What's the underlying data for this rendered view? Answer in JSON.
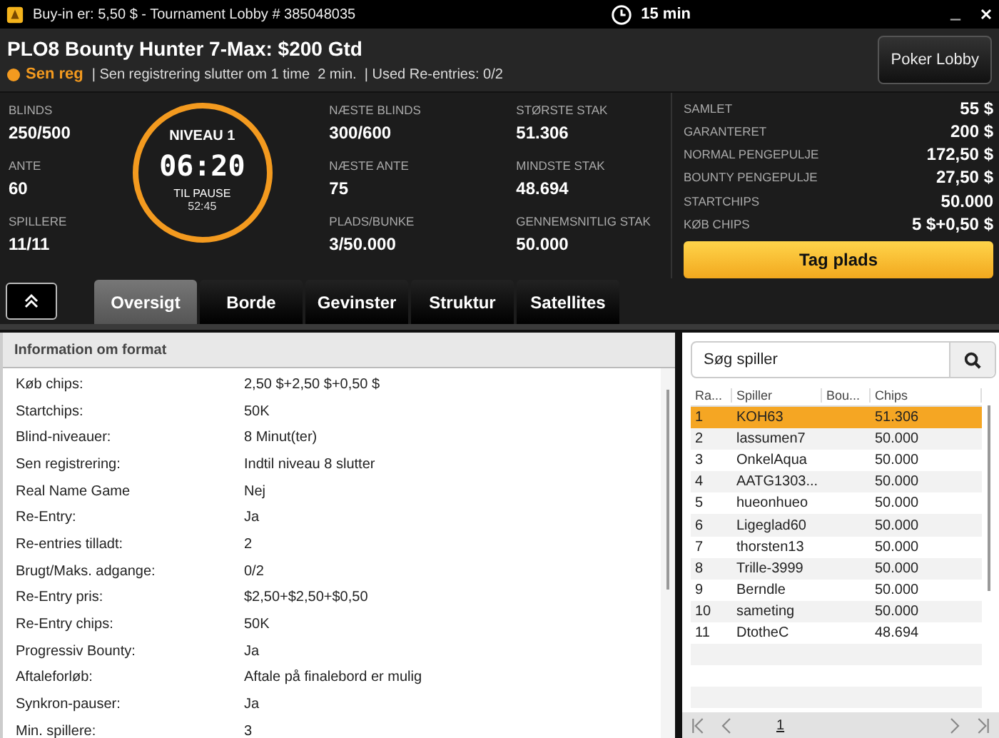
{
  "titlebar": {
    "title": "Buy-in er: 5,50 $ - Tournament Lobby # 385048035",
    "timer": "15 min"
  },
  "header": {
    "name": "PLO8 Bounty Hunter 7-Max: $200 Gtd",
    "status": "Sen reg",
    "info": "| Sen registrering slutter om 1 time  2 min.  | Used Re-entries: 0/2",
    "lobby_button": "Poker Lobby"
  },
  "stats_left": [
    {
      "label": "BLINDS",
      "value": "250/500"
    },
    {
      "label": "ANTE",
      "value": "60"
    },
    {
      "label": "SPILLERE",
      "value": "11/11"
    }
  ],
  "clock": {
    "title": "NIVEAU 1",
    "time": "06:20",
    "pause_label": "TIL PAUSE",
    "pause_time": "52:45"
  },
  "stats_mid": [
    {
      "label": "NÆSTE BLINDS",
      "value": "300/600"
    },
    {
      "label": "NÆSTE ANTE",
      "value": "75"
    },
    {
      "label": "PLADS/BUNKE",
      "value": "3/50.000"
    }
  ],
  "stats_right": [
    {
      "label": "STØRSTE STAK",
      "value": "51.306"
    },
    {
      "label": "MINDSTE STAK",
      "value": "48.694"
    },
    {
      "label": "GENNEMSNITLIG STAK",
      "value": "50.000"
    }
  ],
  "prize": [
    {
      "label": "SAMLET",
      "value": "55 $"
    },
    {
      "label": "GARANTERET",
      "value": "200 $"
    },
    {
      "label": "NORMAL PENGEPULJE",
      "value": "172,50 $"
    },
    {
      "label": "BOUNTY PENGEPULJE",
      "value": "27,50 $"
    },
    {
      "label": "STARTCHIPS",
      "value": "50.000"
    },
    {
      "label": "KØB CHIPS",
      "value": "5 $+0,50 $"
    }
  ],
  "join_button": "Tag plads",
  "tabs": [
    {
      "label": "Oversigt",
      "selected": true
    },
    {
      "label": "Borde",
      "selected": false
    },
    {
      "label": "Gevinster",
      "selected": false
    },
    {
      "label": "Struktur",
      "selected": false
    },
    {
      "label": "Satellites",
      "selected": false
    }
  ],
  "format": {
    "title": "Information om format",
    "rows": [
      {
        "label": "Køb chips:",
        "value": "2,50 $+2,50 $+0,50 $"
      },
      {
        "label": "Startchips:",
        "value": "50K"
      },
      {
        "label": "Blind-niveauer:",
        "value": "8 Minut(ter)"
      },
      {
        "label": "Sen registrering:",
        "value": "Indtil niveau 8 slutter"
      },
      {
        "label": "Real Name Game",
        "value": "Nej"
      },
      {
        "label": "Re-Entry:",
        "value": "Ja"
      },
      {
        "label": "Re-entries tilladt:",
        "value": "2"
      },
      {
        "label": "Brugt/Maks. adgange:",
        "value": "0/2"
      },
      {
        "label": "Re-Entry pris:",
        "value": "$2,50+$2,50+$0,50"
      },
      {
        "label": "Re-Entry chips:",
        "value": "50K"
      },
      {
        "label": "Progressiv Bounty:",
        "value": "Ja"
      },
      {
        "label": "Aftaleforløb:",
        "value": "Aftale på finalebord er mulig"
      },
      {
        "label": "Synkron-pauser:",
        "value": "Ja"
      },
      {
        "label": "Min. spillere:",
        "value": "3"
      }
    ]
  },
  "players": {
    "search_placeholder": "Søg spiller",
    "columns": [
      "Ra...",
      "Spiller",
      "Bou...",
      "Chips"
    ],
    "rows": [
      {
        "rank": "1",
        "name": "KOH63",
        "chips": "51.306",
        "selected": true
      },
      {
        "rank": "2",
        "name": "lassumen7",
        "chips": "50.000",
        "selected": false
      },
      {
        "rank": "3",
        "name": "OnkelAqua",
        "chips": "50.000",
        "selected": false
      },
      {
        "rank": "4",
        "name": "AATG1303...",
        "chips": "50.000",
        "selected": false
      },
      {
        "rank": "5",
        "name": "hueonhueo",
        "chips": "50.000",
        "selected": false
      },
      {
        "rank": "6",
        "name": "Ligeglad60",
        "chips": "50.000",
        "selected": false
      },
      {
        "rank": "7",
        "name": "thorsten13",
        "chips": "50.000",
        "selected": false
      },
      {
        "rank": "8",
        "name": "Trille-3999",
        "chips": "50.000",
        "selected": false
      },
      {
        "rank": "9",
        "name": "Berndle",
        "chips": "50.000",
        "selected": false
      },
      {
        "rank": "10",
        "name": "sameting",
        "chips": "50.000",
        "selected": false
      },
      {
        "rank": "11",
        "name": "DtotheC",
        "chips": "48.694",
        "selected": false
      }
    ],
    "page": "1"
  }
}
